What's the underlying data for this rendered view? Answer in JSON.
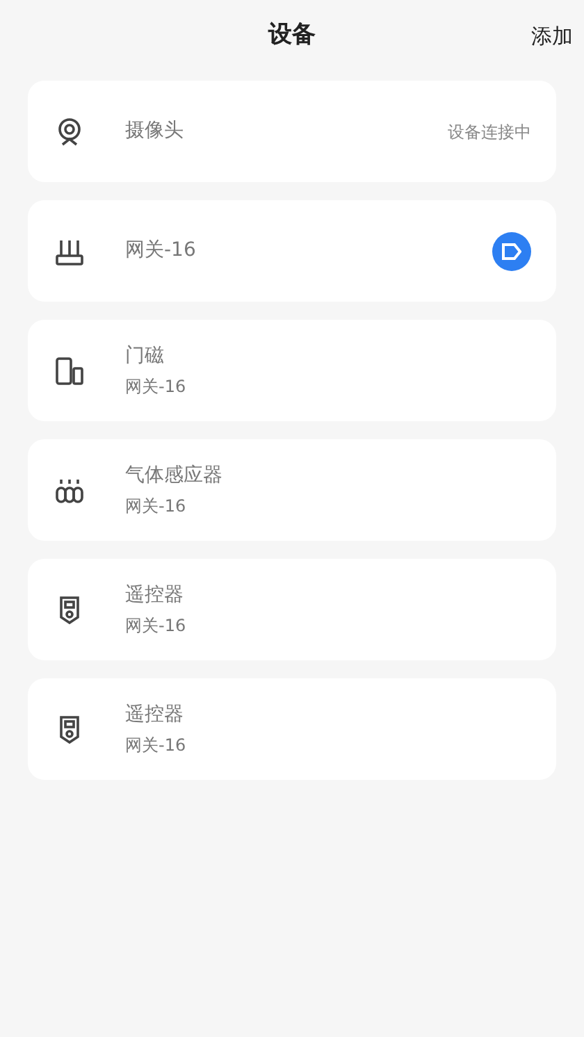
{
  "header": {
    "title": "设备",
    "action": "添加"
  },
  "devices": [
    {
      "kind": "camera",
      "name": "摄像头",
      "status": "设备连接中"
    },
    {
      "kind": "gateway",
      "name": "网关-16",
      "has_action": true
    },
    {
      "kind": "door",
      "name": "门磁",
      "subtitle": "网关-16"
    },
    {
      "kind": "gas",
      "name": "气体感应器",
      "subtitle": "网关-16"
    },
    {
      "kind": "remote",
      "name": "遥控器",
      "subtitle": "网关-16"
    },
    {
      "kind": "remote",
      "name": "遥控器",
      "subtitle": "网关-16"
    }
  ]
}
